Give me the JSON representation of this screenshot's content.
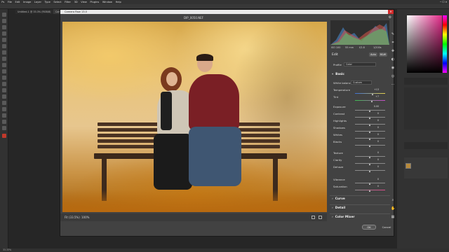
{
  "photoshop": {
    "menu": [
      "Ps",
      "File",
      "Edit",
      "Image",
      "Layer",
      "Type",
      "Select",
      "Filter",
      "3D",
      "View",
      "Plugins",
      "Window",
      "Help"
    ],
    "doc_tabs": [
      "Untitled-1 @ 33.3% (RGB/8)",
      "Camera Raw 13.0"
    ],
    "status": "33.33%"
  },
  "camera_raw": {
    "title": "Camera Raw 13.0",
    "filename": "DIP_0050.NEF",
    "fit_label": "Fit (33.5%)",
    "zoom": "100%",
    "histogram_readout": [
      "R: ---",
      "G: ---",
      "B: ---"
    ],
    "histogram_meta": [
      "ISO 100",
      "55 mm",
      "f/2.8",
      "1/200s"
    ],
    "edit_label": "Edit",
    "auto_label": "Auto",
    "bw_label": "B&W",
    "profile_label": "Profile",
    "profile_value": "Color",
    "basic_label": "Basic",
    "white_balance_label": "White balance",
    "white_balance_value": "Custom",
    "temperature_label": "Temperature",
    "temperature_value": "+13",
    "tint_label": "Tint",
    "tint_value": "+7",
    "exposure_label": "Exposure",
    "exposure_value": "0.00",
    "contrast_label": "Contrast",
    "contrast_value": "0",
    "highlights_label": "Highlights",
    "highlights_value": "0",
    "shadows_label": "Shadows",
    "shadows_value": "0",
    "whites_label": "Whites",
    "whites_value": "0",
    "blacks_label": "Blacks",
    "blacks_value": "0",
    "texture_label": "Texture",
    "texture_value": "0",
    "clarity_label": "Clarity",
    "clarity_value": "0",
    "dehaze_label": "Dehaze",
    "dehaze_value": "0",
    "vibrance_label": "Vibrance",
    "vibrance_value": "0",
    "saturation_label": "Saturation",
    "saturation_value": "0",
    "curve_label": "Curve",
    "detail_label": "Detail",
    "color_mixer_label": "Color Mixer",
    "ok_label": "OK",
    "cancel_label": "Cancel"
  },
  "colors": {
    "dialog_bg": "#424242",
    "accent": "#d12b2b",
    "photo_warm": "#e9c47a"
  }
}
